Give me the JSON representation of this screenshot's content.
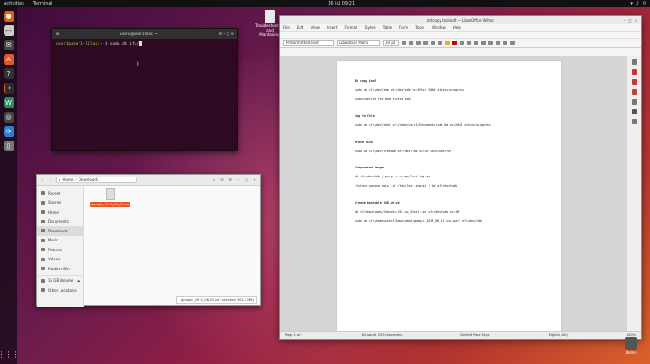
{
  "topbar": {
    "activities": "Activities",
    "app": "Terminal",
    "clock": "16 Jul  09:21"
  },
  "desktop_icon": {
    "label": "Troubleshooting and Maintaining"
  },
  "terminal": {
    "title": "user1@user1-lilac: ~",
    "prompt_user": "user1@user1-lilac:",
    "prompt_path": "~",
    "command": "$ sudo dd if=/"
  },
  "files": {
    "path_home": "Home",
    "path_current": "Downloads",
    "sidebar": [
      "Recent",
      "Starred",
      "Home",
      "Documents",
      "Downloads",
      "Music",
      "Pictures",
      "Videos",
      "Rubbish Bin",
      "16 GB Volume",
      "Other Locations"
    ],
    "file_label": "gmagic_2013_06_01.iso",
    "status": "\"gmagic_2013_06_01.iso\" selected (302.3 MB)"
  },
  "writer": {
    "title": "dd copy tool.odt — LibreOffice Writer",
    "menu": [
      "File",
      "Edit",
      "View",
      "Insert",
      "Format",
      "Styles",
      "Table",
      "Form",
      "Tools",
      "Window",
      "Help"
    ],
    "style_combo": "Preformatted Text",
    "font_combo": "Liberation Mono",
    "size_combo": "10 pt",
    "lines": [
      {
        "text": "DD copy tool",
        "h": true
      },
      {
        "text": "sudo dd if=/dev/sda of=/dev/sdb bs=1M or 2048 status=progress",
        "h": false
      },
      {
        "text": "sudo=noerror  for bad sector sdd",
        "h": false
      },
      {
        "text": "img to file",
        "h": true
      },
      {
        "text": "sudo dd if=/dev/sda1 of=/home/user1/Documents/sda.dd bs=2048 status=progress",
        "h": false
      },
      {
        "text": "erase disk",
        "h": true
      },
      {
        "text": "sudo dd if=/dev/urandom of=/dev/sdb bs=1M conv=noerror",
        "h": false
      },
      {
        "text": "Compressed image",
        "h": true
      },
      {
        "text": "dd if=/dev/sdb | gzip -c >/tmp/lost.img.gz",
        "h": false
      },
      {
        "text": "/extend wasing gzip -dc /tmp/lost.img.gz | dd of=/dev/sdb",
        "h": false
      },
      {
        "text": "Create bootable USB drive",
        "h": true
      },
      {
        "text": "dd if=Downloads/lubuntu-20.iso_64bit.iso of=/dev/sdb bs=1M",
        "h": false
      },
      {
        "text": "sudo dd if=/home/user1/Downloads/gmagic_2013_06_01.iso.part of=/dev/sdb",
        "h": false
      }
    ],
    "status_page": "Page 1 of 1",
    "status_words": "84 words, 555 characters",
    "status_style": "Default Page Style",
    "status_lang": "English (UK)",
    "status_zoom": "100%"
  },
  "trash": {
    "label": "Home"
  }
}
